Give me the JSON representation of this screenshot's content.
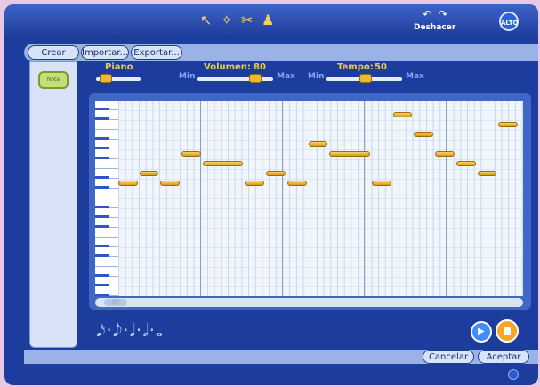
{
  "header": {
    "tools": [
      "pointer-tool",
      "magic-wand-tool",
      "scissors-tool",
      "stamp-tool"
    ],
    "undo_label": "Deshacer",
    "alto_badge": "ALTO"
  },
  "toolbar": {
    "crear": "Crear",
    "importar": "Importar...",
    "exportar": "Exportar..."
  },
  "sidebar": {
    "instrument_label": "Nota"
  },
  "controls": {
    "instrument": "Piano",
    "volume_label": "Volumen:",
    "volume_value": "80",
    "volume_level": 0.8,
    "tempo_label": "Tempo:",
    "tempo_value": "50",
    "tempo_level": 0.5,
    "min": "Min",
    "max": "Max"
  },
  "notes": [
    {
      "start": 0.0,
      "length": 1.0,
      "pitch": 12
    },
    {
      "start": 1.0,
      "length": 1.0,
      "pitch": 13
    },
    {
      "start": 2.0,
      "length": 1.0,
      "pitch": 12
    },
    {
      "start": 3.0,
      "length": 1.0,
      "pitch": 15
    },
    {
      "start": 4.0,
      "length": 2.0,
      "pitch": 14
    },
    {
      "start": 6.0,
      "length": 1.0,
      "pitch": 12
    },
    {
      "start": 7.0,
      "length": 1.0,
      "pitch": 13
    },
    {
      "start": 8.0,
      "length": 1.0,
      "pitch": 12
    },
    {
      "start": 9.0,
      "length": 1.0,
      "pitch": 16
    },
    {
      "start": 10.0,
      "length": 2.0,
      "pitch": 15
    },
    {
      "start": 12.0,
      "length": 1.0,
      "pitch": 12
    },
    {
      "start": 13.0,
      "length": 1.0,
      "pitch": 19
    },
    {
      "start": 14.0,
      "length": 1.0,
      "pitch": 17
    },
    {
      "start": 15.0,
      "length": 1.0,
      "pitch": 15
    },
    {
      "start": 16.0,
      "length": 1.0,
      "pitch": 14
    },
    {
      "start": 17.0,
      "length": 1.0,
      "pitch": 13
    },
    {
      "start": 18.0,
      "length": 1.0,
      "pitch": 18
    }
  ],
  "note_range": {
    "beats": 19,
    "pitches": 20
  },
  "durations": "𝅘𝅥𝅯·𝅘𝅥𝅮·𝅘𝅥·𝅗𝅥·𝅝",
  "buttons": {
    "cancel": "Cancelar",
    "accept": "Aceptar"
  },
  "colors": {
    "accent": "#f0c850",
    "note": "#e8b830",
    "frame": "#1d3d9e"
  }
}
